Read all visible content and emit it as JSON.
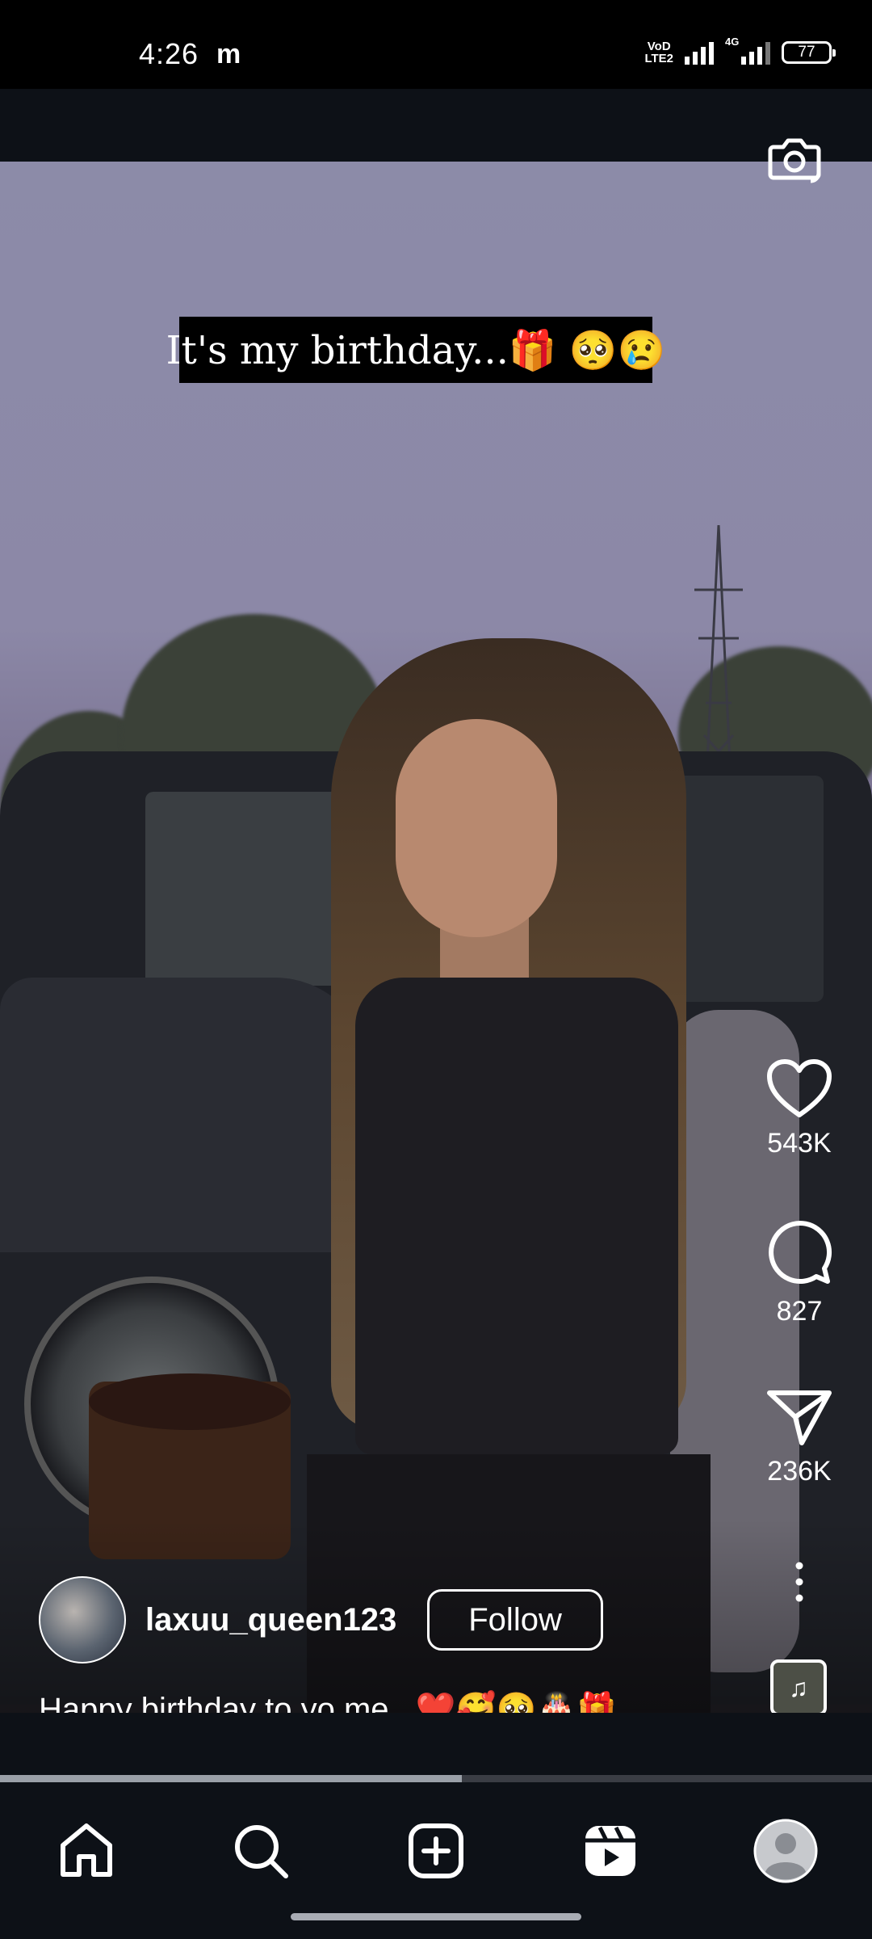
{
  "status_bar": {
    "time": "4:26",
    "carrier_icon": "m",
    "volte_top": "VoD",
    "volte_bottom": "LTE2",
    "network_label": "4G",
    "battery": "77"
  },
  "reel": {
    "overlay_text": "It's my birthday...🎁 🥺😢",
    "camera_icon": "camera-icon",
    "likes": "543K",
    "comments": "827",
    "shares": "236K",
    "username": "laxuu_queen123",
    "follow_label": "Follow",
    "caption": "Happy birthday to yo me...❤️🥰🥺🎂🎁  ...",
    "music_icon": "music-note-icon",
    "music_glyph": "♫",
    "progress_fraction": 0.53
  },
  "nav": {
    "items": [
      "home-icon",
      "search-icon",
      "create-icon",
      "reels-icon",
      "profile-icon"
    ]
  }
}
